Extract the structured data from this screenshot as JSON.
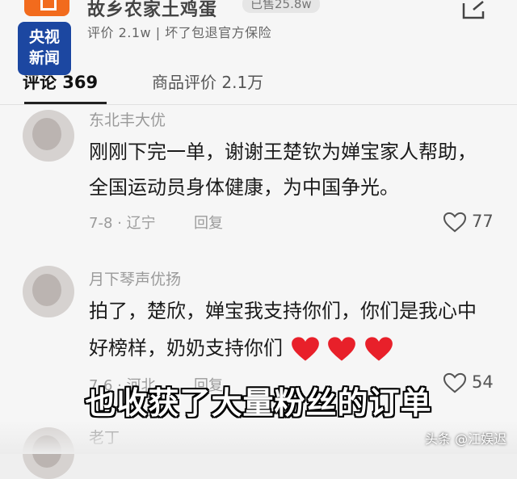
{
  "header": {
    "store_title": "故乡农家土鸡蛋",
    "sold_badge": "已售25.8w",
    "subline": "评价 2.1w | 坏了包退官方保险",
    "icons": {
      "store": "store-icon",
      "share": "share-icon"
    }
  },
  "tabs": [
    {
      "label": "评论 369",
      "active": true
    },
    {
      "label": "商品评价 2.1万",
      "active": false
    }
  ],
  "comments": [
    {
      "username": "东北丰大优",
      "lines": [
        "刚刚下完一单，谢谢王楚钦为婵宝家人帮助，",
        "全国运动员身体健康，为中国争光。"
      ],
      "date_location": "7-8 · 辽宁",
      "reply_label": "回复",
      "likes": "77"
    },
    {
      "username": "月下琴声优扬",
      "lines": [
        "拍了，楚欣，婵宝我支持你们，你们是我心中",
        "好榜样，奶奶支持你们"
      ],
      "emoji_hearts": 3,
      "date_location": "7-6 · 河北",
      "reply_label": "回复",
      "likes": "54"
    },
    {
      "username": "老丁"
    }
  ],
  "overlay": {
    "logo_line1": "央视",
    "logo_line2": "新闻",
    "subtitle": "也收获了大量粉丝的订单",
    "watermark": "头条 @江娱迟"
  },
  "colors": {
    "accent_orange": "#f26b1d",
    "logo_blue": "#1c47a1",
    "heart_red": "#e8202a"
  }
}
